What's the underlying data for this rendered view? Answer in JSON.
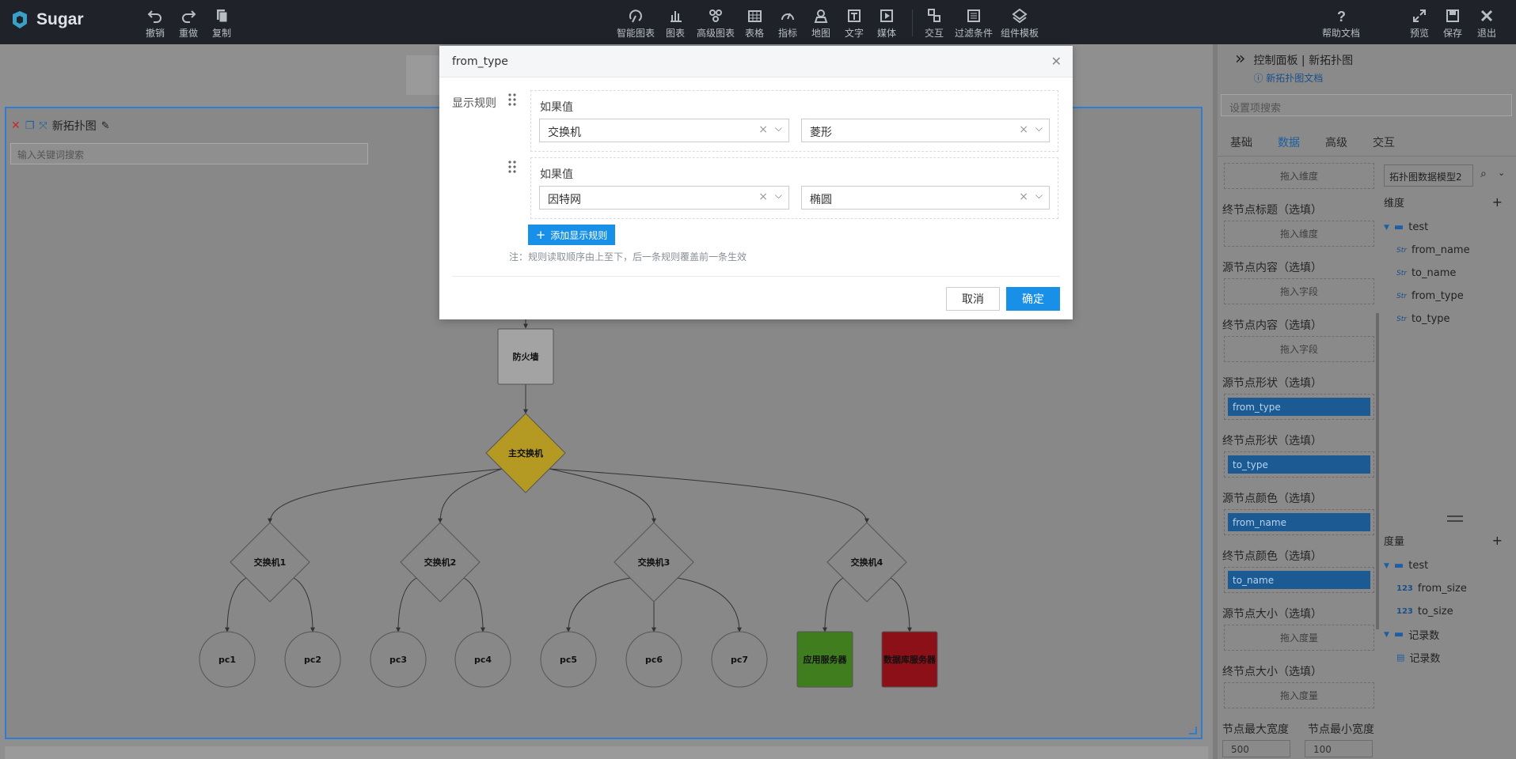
{
  "app": {
    "name": "Sugar"
  },
  "toolbar_left": [
    {
      "label": "撤销",
      "icon": "undo-icon"
    },
    {
      "label": "重做",
      "icon": "redo-icon"
    },
    {
      "label": "复制",
      "icon": "copy-icon"
    }
  ],
  "toolbar_center": [
    {
      "label": "智能图表",
      "icon": "smart-chart-icon"
    },
    {
      "label": "图表",
      "icon": "bar-chart-icon"
    },
    {
      "label": "高级图表",
      "icon": "advanced-chart-icon"
    },
    {
      "label": "表格",
      "icon": "table-icon"
    },
    {
      "label": "指标",
      "icon": "gauge-icon"
    },
    {
      "label": "地图",
      "icon": "map-pin-icon"
    },
    {
      "label": "文字",
      "icon": "text-icon"
    },
    {
      "label": "媒体",
      "icon": "media-icon"
    },
    {
      "label": "交互",
      "icon": "interaction-icon"
    },
    {
      "label": "过滤条件",
      "icon": "filter-icon"
    },
    {
      "label": "组件模板",
      "icon": "template-icon"
    }
  ],
  "toolbar_right": [
    {
      "label": "帮助文档",
      "icon": "help-icon"
    },
    {
      "label": "预览",
      "icon": "expand-icon"
    },
    {
      "label": "保存",
      "icon": "save-icon"
    },
    {
      "label": "退出",
      "icon": "close-icon"
    }
  ],
  "canvas": {
    "title": "新拓扑图",
    "search_placeholder": "输入关键词搜索"
  },
  "graph": {
    "nodes": [
      {
        "id": "fw",
        "label": "防火墙",
        "shape": "rect",
        "color": "#a3a3a3"
      },
      {
        "id": "core",
        "label": "主交换机",
        "shape": "diamond",
        "color": "#b49a22"
      },
      {
        "id": "s1",
        "label": "交换机1",
        "shape": "diamond",
        "color": "#888888"
      },
      {
        "id": "s2",
        "label": "交换机2",
        "shape": "diamond",
        "color": "#888888"
      },
      {
        "id": "s3",
        "label": "交换机3",
        "shape": "diamond",
        "color": "#888888"
      },
      {
        "id": "s4",
        "label": "交换机4",
        "shape": "diamond",
        "color": "#888888"
      },
      {
        "id": "pc1",
        "label": "pc1",
        "shape": "circle",
        "color": "#888888"
      },
      {
        "id": "pc2",
        "label": "pc2",
        "shape": "circle",
        "color": "#888888"
      },
      {
        "id": "pc3",
        "label": "pc3",
        "shape": "circle",
        "color": "#888888"
      },
      {
        "id": "pc4",
        "label": "pc4",
        "shape": "circle",
        "color": "#888888"
      },
      {
        "id": "pc5",
        "label": "pc5",
        "shape": "circle",
        "color": "#888888"
      },
      {
        "id": "pc6",
        "label": "pc6",
        "shape": "circle",
        "color": "#888888"
      },
      {
        "id": "pc7",
        "label": "pc7",
        "shape": "circle",
        "color": "#888888"
      },
      {
        "id": "app",
        "label": "应用服务器",
        "shape": "rect",
        "color": "#3f7d1f"
      },
      {
        "id": "db",
        "label": "数据库服务器",
        "shape": "rect",
        "color": "#8c1018"
      }
    ],
    "edges": [
      [
        "fw",
        "core"
      ],
      [
        "core",
        "s1"
      ],
      [
        "core",
        "s2"
      ],
      [
        "core",
        "s3"
      ],
      [
        "core",
        "s4"
      ],
      [
        "s1",
        "pc1"
      ],
      [
        "s1",
        "pc2"
      ],
      [
        "s2",
        "pc3"
      ],
      [
        "s2",
        "pc4"
      ],
      [
        "s3",
        "pc5"
      ],
      [
        "s3",
        "pc6"
      ],
      [
        "s3",
        "pc7"
      ],
      [
        "s4",
        "app"
      ],
      [
        "s4",
        "db"
      ]
    ]
  },
  "right_panel": {
    "title": "控制面板 | 新拓扑图",
    "doc_link": "新拓扑图文档",
    "search_placeholder": "设置项搜索",
    "tabs": [
      "基础",
      "数据",
      "高级",
      "交互"
    ],
    "active_tab": "数据",
    "fields": [
      {
        "label": "",
        "value": "拖入维度",
        "filled": false
      },
      {
        "label": "终节点标题（选填）",
        "value": "拖入维度",
        "filled": false
      },
      {
        "label": "源节点内容（选填）",
        "value": "拖入字段",
        "filled": false
      },
      {
        "label": "终节点内容（选填）",
        "value": "拖入字段",
        "filled": false
      },
      {
        "label": "源节点形状（选填）",
        "value": "from_type",
        "filled": true
      },
      {
        "label": "终节点形状（选填）",
        "value": "to_type",
        "filled": true
      },
      {
        "label": "源节点颜色（选填）",
        "value": "from_name",
        "filled": true
      },
      {
        "label": "终节点颜色（选填）",
        "value": "to_name",
        "filled": true
      },
      {
        "label": "源节点大小（选填）",
        "value": "拖入度量",
        "filled": false
      },
      {
        "label": "终节点大小（选填）",
        "value": "拖入度量",
        "filled": false
      }
    ],
    "bottom_labels": [
      "节点最大宽度",
      "节点最小宽度"
    ],
    "bottom_values": [
      "500",
      "100"
    ],
    "model_select": "拓扑图数据模型2",
    "dimension_title": "维度",
    "dimension_folder": "test",
    "dimensions": [
      "from_name",
      "to_name",
      "from_type",
      "to_type"
    ],
    "measure_title": "度量",
    "measure_folder": "test",
    "measures": [
      "from_size",
      "to_size"
    ],
    "record_folder": "记录数",
    "record_item": "记录数"
  },
  "modal": {
    "title": "from_type",
    "section_label": "显示规则",
    "rules": [
      {
        "cond_label": "如果值",
        "value": "交换机",
        "shape": "菱形"
      },
      {
        "cond_label": "如果值",
        "value": "因特网",
        "shape": "椭圆"
      }
    ],
    "add_rule": "添加显示规则",
    "note": "注：规则读取顺序由上至下，后一条规则覆盖前一条生效",
    "cancel": "取消",
    "ok": "确定"
  }
}
